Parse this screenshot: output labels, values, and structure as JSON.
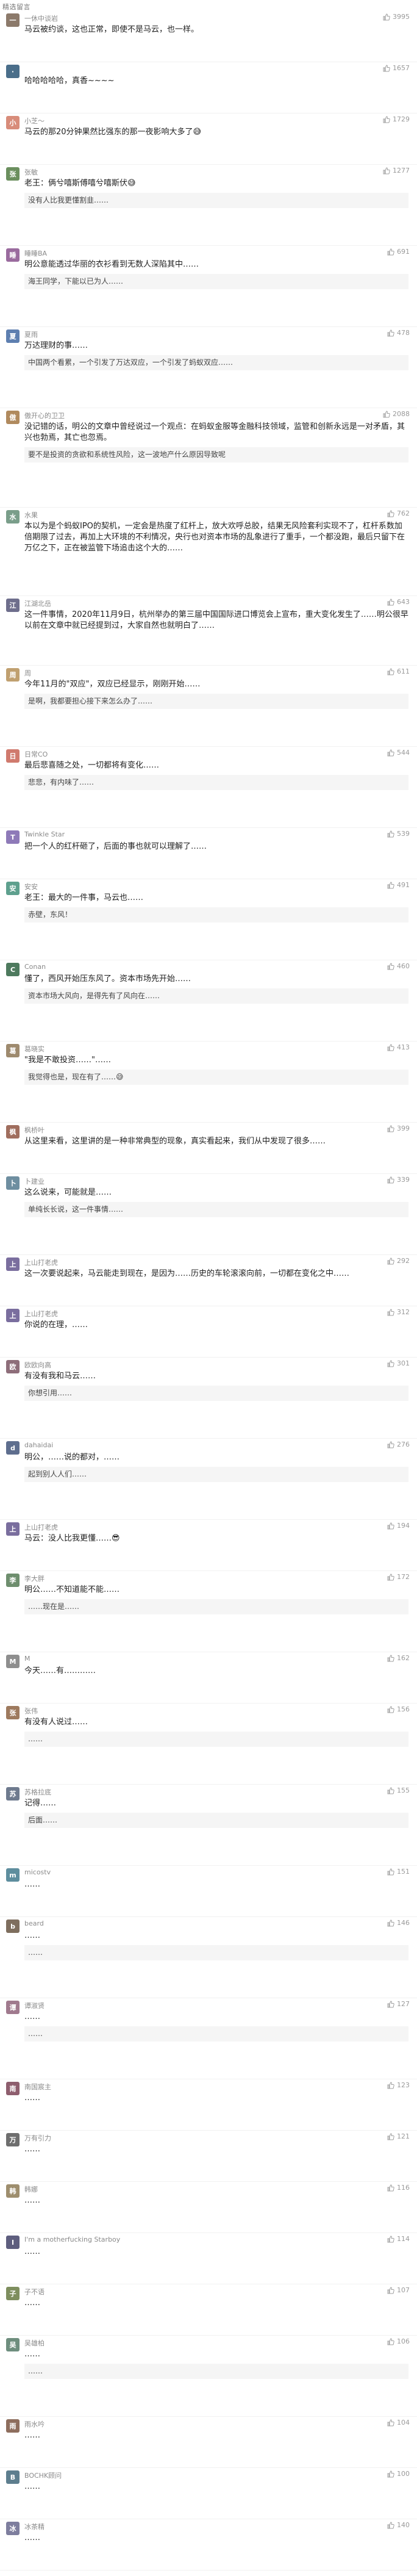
{
  "section_title": "精选留言",
  "comments": [
    {
      "author": "一休中谈岩",
      "avatar_color": "#8c7a6b",
      "likes": "3995",
      "text": "马云被约谈，这也正常，即使不是马云，也一样。",
      "reply_author": "",
      "reply": ""
    },
    {
      "author": "",
      "avatar_color": "#4a6e8a",
      "likes": "1657",
      "text": "哈哈哈哈哈，真香~~~~",
      "reply_author": "",
      "reply": ""
    },
    {
      "author": "小芝～",
      "avatar_color": "#d88c7a",
      "likes": "1729",
      "text": "马云的那20分钟果然比强东的那一夜影响大多了😅",
      "reply_author": "",
      "reply": ""
    },
    {
      "author": "张敏",
      "avatar_color": "#6b8f5e",
      "likes": "1277",
      "text": "老王：俩兮嘻斯傅嘻兮嘻斯伏😅",
      "reply_author": "",
      "reply": "没有人比我更懂割韭……"
    },
    {
      "author": "睡睡BA",
      "avatar_color": "#9a6b9e",
      "likes": "691",
      "text": "明公意能透过华丽的衣衫看到无数人深陷其中……",
      "reply_author": "",
      "reply": "海王同学，下能以已为人……"
    },
    {
      "author": "夏雨",
      "avatar_color": "#5e7fb0",
      "likes": "478",
      "text": "万达理财的事……",
      "reply_author": "",
      "reply": "中国两个看累，一个引发了万达双应，一个引发了蚂蚁双应……"
    },
    {
      "author": "傲开心的卫卫",
      "avatar_color": "#b08a5e",
      "likes": "2088",
      "text": "没记错的话，明公的文章中曾经说过一个观点：在蚂蚁金服等金融科技领域，监管和创新永远是一对矛盾，其兴也勃焉，其亡也忽焉。",
      "reply_author": "",
      "reply": "要不是投资的贪欲和系统性风险，这一波地产什么原因导致呢"
    },
    {
      "author": "水果",
      "avatar_color": "#7a9e8a",
      "likes": "762",
      "text": "本以为是个蚂蚁IPO的契机，一定会是热度了红杆上，放大欢呼总胶，结果无风险套利实现不了，杠杆系数加倍期限了过去，再加上大环境的不利情况，央行也对资本市场的乱象进行了重手，一个都没跑，最后只留下在万亿之下，正在被监管下场追击这个大的……",
      "reply_author": "",
      "reply": ""
    },
    {
      "author": "江湖北岳",
      "avatar_color": "#6e6e8c",
      "likes": "643",
      "text": "这一件事情，2020年11月9日，杭州举办的第三届中国国际进口博览会上宣布，重大变化发生了……明公很早以前在文章中就已经提到过，大家自然也就明白了……",
      "reply_author": "",
      "reply": ""
    },
    {
      "author": "周 ",
      "avatar_color": "#c0a070",
      "likes": "611",
      "text": "今年11月的\"双应\"，双应已经显示，刚刚开始……",
      "reply_author": "",
      "reply": "是啊，我都要担心接下来怎么办了……"
    },
    {
      "author": "日常CO",
      "avatar_color": "#d07a6e",
      "likes": "544",
      "text": "最后悲喜随之处，一切都将有变化……",
      "reply_author": "",
      "reply": "悲悲，有内味了……"
    },
    {
      "author": "Twinkle Star",
      "avatar_color": "#8e7ab8",
      "likes": "539",
      "text": "把一个人的红杆砸了，后面的事也就可以理解了……",
      "reply_author": "",
      "reply": ""
    },
    {
      "author": "安安",
      "avatar_color": "#5ea08e",
      "likes": "491",
      "text": "老王：最大的一件事，马云也……",
      "reply_author": "",
      "reply": "赤壁，东风！"
    },
    {
      "author": "Conan",
      "avatar_color": "#4e7a5e",
      "likes": "460",
      "text": "懂了，西风开始压东风了。资本市场先开始……",
      "reply_author": "",
      "reply": "资本市场大风向，是得先有了风向在……"
    },
    {
      "author": "葛晓实",
      "avatar_color": "#9e8a6e",
      "likes": "413",
      "text": "\"我是不敢投资……\"……",
      "reply_author": "",
      "reply": "我觉得也是，现在有了……😅"
    },
    {
      "author": "枫桥叶",
      "avatar_color": "#a06e5e",
      "likes": "399",
      "text": "从这里来看，这里讲的是一种非常典型的现象，真实看起来，我们从中发现了很多……",
      "reply_author": "",
      "reply": ""
    },
    {
      "author": "卜建业",
      "avatar_color": "#6e8ea0",
      "likes": "339",
      "text": "这么说来，可能就是……",
      "reply_author": "",
      "reply": "单纯长长说，这一件事情……"
    },
    {
      "author": "上山打老虎",
      "avatar_color": "#7a6e9e",
      "likes": "292",
      "text": "这一次要说起来，马云能走到现在，是因为……历史的车轮滚滚向前，一切都在变化之中……",
      "reply_author": "",
      "reply": ""
    },
    {
      "author": "上山打老虎",
      "avatar_color": "#7a6e9e",
      "likes": "312",
      "text": "你说的在理，……",
      "reply_author": "",
      "reply": ""
    },
    {
      "author": "欧欧向高",
      "avatar_color": "#8e6e7a",
      "likes": "301",
      "text": "有没有我和马云……",
      "reply_author": "",
      "reply": "你想引用……"
    },
    {
      "author": "dahaidai",
      "avatar_color": "#5e6e8e",
      "likes": "276",
      "text": "明公，……说的都对，……",
      "reply_author": "",
      "reply": "起到别人人们……"
    },
    {
      "author": "上山打老虎",
      "avatar_color": "#7a6e9e",
      "likes": "194",
      "text": "马云：没人比我更懂……😎",
      "reply_author": "",
      "reply": ""
    },
    {
      "author": "李大胖",
      "avatar_color": "#6e8e6e",
      "likes": "172",
      "text": "明公……不知道能不能……",
      "reply_author": "",
      "reply": "……现在是……"
    },
    {
      "author": "M",
      "avatar_color": "#8e8e8e",
      "likes": "162",
      "text": "今天……有…………",
      "reply_author": "",
      "reply": ""
    },
    {
      "author": "张伟",
      "avatar_color": "#9e7a5e",
      "likes": "156",
      "text": "有没有人说过……",
      "reply_author": "",
      "reply": "……"
    },
    {
      "author": "苏格拉底",
      "avatar_color": "#6e7a8e",
      "likes": "155",
      "text": "记得……",
      "reply_author": "",
      "reply": "后面……"
    },
    {
      "author": "micostv",
      "avatar_color": "#5e8e9e",
      "likes": "151",
      "text": "……",
      "reply_author": "",
      "reply": ""
    },
    {
      "author": "beard",
      "avatar_color": "#7e6e5e",
      "likes": "146",
      "text": "……",
      "reply_author": "",
      "reply": "……"
    },
    {
      "author": "谭淑贤",
      "avatar_color": "#a07a8e",
      "likes": "127",
      "text": "……",
      "reply_author": "",
      "reply": "……"
    },
    {
      "author": "南国宸主",
      "avatar_color": "#8e5e6e",
      "likes": "123",
      "text": "……",
      "reply_author": "",
      "reply": ""
    },
    {
      "author": "万有引力",
      "avatar_color": "#6e6e6e",
      "likes": "121",
      "text": "……",
      "reply_author": "",
      "reply": ""
    },
    {
      "author": "韩娜",
      "avatar_color": "#9e8e6e",
      "likes": "116",
      "text": "……",
      "reply_author": "",
      "reply": ""
    },
    {
      "author": "I'm a motherfucking Starboy",
      "avatar_color": "#5e5e7e",
      "likes": "114",
      "text": "……",
      "reply_author": "",
      "reply": ""
    },
    {
      "author": "子不语",
      "avatar_color": "#7e8e5e",
      "likes": "107",
      "text": "……",
      "reply_author": "",
      "reply": ""
    },
    {
      "author": "吴雄柏",
      "avatar_color": "#6e8e7e",
      "likes": "106",
      "text": "……",
      "reply_author": "",
      "reply": "……"
    },
    {
      "author": "雨水吟",
      "avatar_color": "#8e6e5e",
      "likes": "104",
      "text": "……",
      "reply_author": "",
      "reply": ""
    },
    {
      "author": "BOCHK顾问",
      "avatar_color": "#5e7e8e",
      "likes": "100",
      "text": "……",
      "reply_author": "",
      "reply": ""
    },
    {
      "author": "冰茶精",
      "avatar_color": "#7e7e9e",
      "likes": "140",
      "text": "……",
      "reply_author": "",
      "reply": ""
    }
  ]
}
